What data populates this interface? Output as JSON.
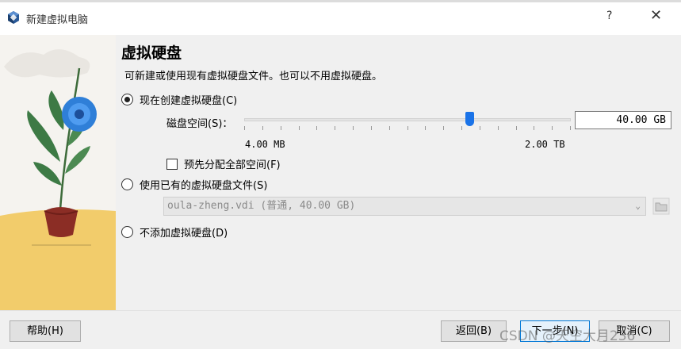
{
  "window": {
    "title": "新建虚拟电脑",
    "help_glyph": "?",
    "close_glyph": "✕"
  },
  "page": {
    "heading": "虚拟硬盘",
    "description": "可新建或使用现有虚拟硬盘文件。也可以不用虚拟硬盘。"
  },
  "options": {
    "create_new": {
      "label": "现在创建虚拟硬盘(C)",
      "selected": true
    },
    "use_existing": {
      "label": "使用已有的虚拟硬盘文件(S)",
      "selected": false
    },
    "no_disk": {
      "label": "不添加虚拟硬盘(D)",
      "selected": false
    }
  },
  "disk_size": {
    "label": "磁盘空间(S)：",
    "value": "40.00 GB",
    "min_label": "4.00 MB",
    "max_label": "2.00 TB",
    "slider_fraction": 0.69
  },
  "preallocate": {
    "label": "预先分配全部空间(F)",
    "checked": false
  },
  "existing_file": {
    "value": "oula-zheng.vdi (普通, 40.00 GB)",
    "chevron": "⌄"
  },
  "buttons": {
    "help": "帮助(H)",
    "back": "返回(B)",
    "next": "下一步(N)",
    "cancel": "取消(C)"
  },
  "watermark": "CSDN @天空大月236",
  "colors": {
    "accent": "#1a73e8",
    "primary_border": "#0078d7"
  }
}
